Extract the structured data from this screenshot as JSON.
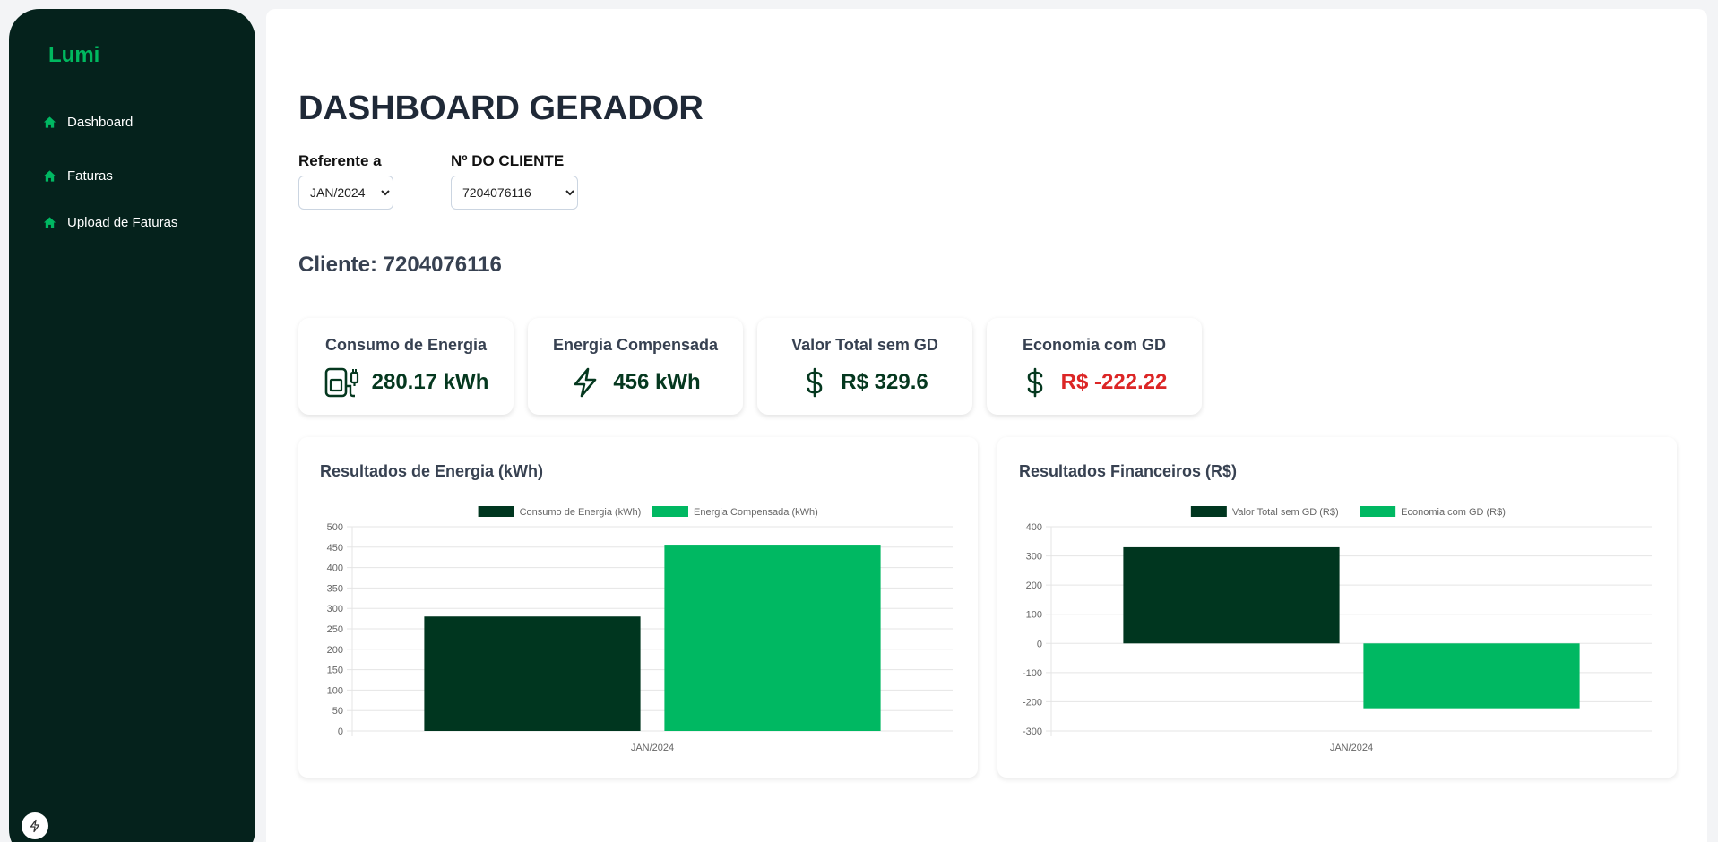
{
  "app": {
    "logo": "Lumi"
  },
  "sidebar": {
    "items": [
      {
        "label": "Dashboard",
        "icon": "home-icon"
      },
      {
        "label": "Faturas",
        "icon": "home-icon"
      },
      {
        "label": "Upload de Faturas",
        "icon": "home-icon"
      }
    ]
  },
  "page": {
    "title": "DASHBOARD GERADOR"
  },
  "filters": {
    "period_label": "Referente a",
    "period_value": "JAN/2024",
    "client_label": "Nº DO CLIENTE",
    "client_value": "7204076116"
  },
  "client": {
    "title": "Cliente: 7204076116"
  },
  "cards": [
    {
      "title": "Consumo de Energia",
      "value": "280.17 kWh",
      "icon": "ev-charger-icon"
    },
    {
      "title": "Energia Compensada",
      "value": "456 kWh",
      "icon": "lightning-icon"
    },
    {
      "title": "Valor Total sem GD",
      "value": "R$ 329.6",
      "icon": "dollar-icon"
    },
    {
      "title": "Economia com GD",
      "value": "R$ -222.22",
      "icon": "dollar-icon"
    }
  ],
  "colors": {
    "dark_green": "#00361f",
    "light_green": "#00b862",
    "negative": "#dc2626",
    "sidebar_bg": "#05221c"
  },
  "chart_data": [
    {
      "type": "bar",
      "title": "Resultados de Energia (kWh)",
      "categories": [
        "JAN/2024"
      ],
      "series": [
        {
          "name": "Consumo de Energia (kWh)",
          "values": [
            280.17
          ],
          "color": "#00361f"
        },
        {
          "name": "Energia Compensada (kWh)",
          "values": [
            456
          ],
          "color": "#00b862"
        }
      ],
      "ylim": [
        0,
        500
      ],
      "yticks": [
        0,
        50,
        100,
        150,
        200,
        250,
        300,
        350,
        400,
        450,
        500
      ],
      "legend": "top-center",
      "grid": true
    },
    {
      "type": "bar",
      "title": "Resultados Financeiros (R$)",
      "categories": [
        "JAN/2024"
      ],
      "series": [
        {
          "name": "Valor Total sem GD (R$)",
          "values": [
            329.6
          ],
          "color": "#00361f"
        },
        {
          "name": "Economia com GD (R$)",
          "values": [
            -222.22
          ],
          "color": "#00b862"
        }
      ],
      "ylim": [
        -300,
        400
      ],
      "yticks": [
        -300,
        -200,
        -100,
        0,
        100,
        200,
        300,
        400
      ],
      "legend": "top-center",
      "grid": true
    }
  ]
}
